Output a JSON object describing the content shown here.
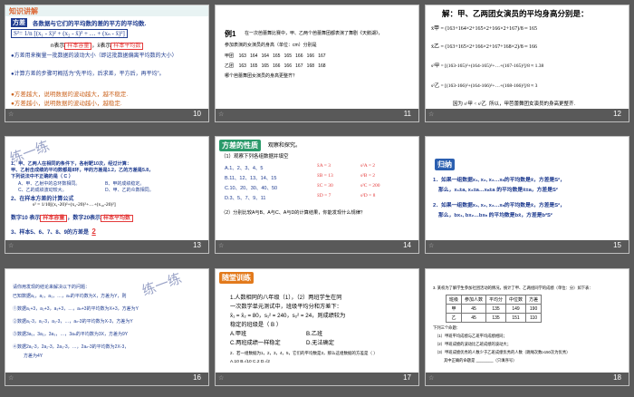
{
  "slides": [
    {
      "num": "10",
      "header": "知识讲解",
      "title": "方差",
      "line1": "各数据与它们的平均数的差的平方的平均数.",
      "formula": "S²= 1/n [(x₁ - x̄)² + (x₂ - x̄)² + … + (xₙ - x̄)²]",
      "line2a": "n表示",
      "line2b": "样本容量",
      "line2c": "，x̄表示",
      "line2d": "样本平均数",
      "line3": "●方差用来衡量一批数据的波动大小（即这批数据偏离平均数的大小）",
      "line4": "●计算方差的步骤可概括为“先平均，后求差，平方后，再平均”。",
      "line5": "●方差越大，说明数据的波动越大，越不稳定.",
      "line6": "●方差越小，说明数据的波动越小，越稳定."
    },
    {
      "num": "11",
      "ex": "例1",
      "l1": "在一次芭蕾舞比赛中，甲、乙两个芭蕾舞团都表演了舞剧《天鹅湖》，",
      "l2": "参加表演的女演员的身高（单位：cm）分别是",
      "rowA_label": "甲团",
      "rowA": [
        "163",
        "164",
        "164",
        "165",
        "165",
        "166",
        "166",
        "167"
      ],
      "rowB_label": "乙团",
      "rowB": [
        "163",
        "165",
        "165",
        "166",
        "166",
        "167",
        "168",
        "168"
      ],
      "l3": "哪个芭蕾舞团女演员的身高更整齐？"
    },
    {
      "num": "12",
      "title": "解：甲、乙两团女演员的平均身高分别是：",
      "f1": "x̄甲 = (163+164×2+165×2+166×2+167)/8 ≈ 165",
      "f2": "x̄乙 = (163+165×2+166×2+167+168×2)/8 ≈ 166",
      "f3": "s²甲 = [(163-165)²+(164-165)²+…+(167-165)²]/8 ≈ 1.38",
      "f4": "s²乙 = [(163-166)²+(164-166)²+…+(168-166)²]/8 ≈ 3",
      "f5a": "因为",
      "f5b": "s²甲 < s²乙",
      "f5c": "所以，甲芭蕾舞团女演员的身高更整齐."
    },
    {
      "num": "13",
      "stamp": "练一练",
      "q1": "1、甲、乙两人在相同的条件下，各射靶10次，经过计算：",
      "q1b": "甲、乙射击成绩的平均数都是8环，甲的方差是1.2，乙的方差是5.8，",
      "q1c": "下列说法中不正确的是（  C  ）",
      "o1": "A、甲、乙射中的总环数相同。",
      "o2": "B、甲的成绩稳定。",
      "o3": "C、乙的成绩波动较大。",
      "o4": "D、甲、乙的众数相同。",
      "q2": "2、在样本方差的计算公式",
      "q2f": "s² = 1/10[(x₁-20)²+(x₂-20)²+…+(x₁₀-20)²]",
      "q2a": "数字10 表示",
      "q2b": "样本容量",
      "q2c": "，数字20表示",
      "q2d": "样本平均数",
      "q3": "3、样本5、6、7、8、9的方差是",
      "q3v": "2"
    },
    {
      "num": "14",
      "hdr": "方差的性质",
      "sub": "观察和探究。",
      "p1": "（1）观察下列各组数据并填空",
      "A": "A.1、2、3、4、5",
      "B": "B.11、12、13、14、15",
      "C": "C.10、20、30、40、50",
      "D": "D.3、5、7、9、11",
      "xa": "x̄A = 3",
      "sa": "s²A = 2",
      "xb": "x̄B = 13",
      "sb": "s²B = 2",
      "xc": "x̄C = 30",
      "sc": "s²C = 200",
      "xd": "x̄D = 7",
      "sd": "s²D = 8",
      "p2": "（2）分别比较A与B、A与C、A与D的计算结果，你能发现什么规律？"
    },
    {
      "num": "15",
      "hdr": "归纳",
      "r1": "1．如果一组数据x₁, x₂, x₃…xₙ的平均数是x̄，方差是S²，",
      "r1b": "那么，x₁±a, x₂±a…xₙ±a 的平均数是x̄±a，方差是S²",
      "r2": "2．如果一组数据x₁, x₂, x₃…xₙ的平均数是x̄，方差是S²，",
      "r2b": "那么，bx₁, bx₂…bxₙ 的平均数是bx̄，方差是b²S²"
    },
    {
      "num": "16",
      "stamp": "练一练",
      "l0": "请你用发现的结论来解决以下的问题：",
      "l1": "已知数据a₁，a₂，a₃，…，aₙ的平均数为X，方差为Y，则",
      "l2": "①数据a₁+3，a₂+3，a₃+3，…，aₙ+3的平均数为X+3，方差为Y",
      "l3": "②数据a₁-3，a₂-3，a₃-3，…，aₙ-3的平均数为X-3，方差为Y",
      "l4": "③数据3a₁，3a₂，3a₃，…，3aₙ的平均数为3X，方差为9Y",
      "l5": "④数据2a₁-3，2a₂-3，2a₃-3，…，2aₙ-3的平均数为2X-3，",
      "l5b": "方差为4Y"
    },
    {
      "num": "17",
      "hdr": "随堂训练",
      "q1": "1.人数相同的八年级（1），（2）两班学生在同",
      "q1b": "一次数学单元测试中，班级平均分和方差下：",
      "q1c": "x̄₁ = x̄₂ = 80，s₁² = 240，s₂² = 24，则成绩较为",
      "q1d": "稳定的班级是（ B ）",
      "oA": "A.甲班",
      "oB": "B.乙班",
      "oC": "C.两班成绩一样稳定",
      "oD": "D.无法确定",
      "q2": "2．若一组数据为1，2，3，4，5，它们的平均数是3，那么这组数据的方差是（ ）",
      "q2o": "A.10    B.√10    C.2    D.√2"
    },
    {
      "num": "18",
      "l1": "3. 某校为了解学生参加社团活动的情况，统计了甲、乙两组同学的成绩（单位：分）如下表：",
      "th": [
        "班级",
        "参加人数",
        "平均分",
        "中位数",
        "方差"
      ],
      "r1": [
        "甲",
        "45",
        "135",
        "149",
        "190"
      ],
      "r2": [
        "乙",
        "45",
        "135",
        "151",
        "110"
      ],
      "l2": "下列三个命题：",
      "l3": "（1）甲班平均成绩与乙班平均成绩相同；",
      "l4": "（2）甲班成绩的波动比乙班成绩的波动大；",
      "l5": "（3）甲班成绩优秀的人数少于乙班成绩优秀的人数（跳绳次数≥150次为优秀）",
      "l6": "其中正确的命题是 ________（只填序号）"
    }
  ]
}
